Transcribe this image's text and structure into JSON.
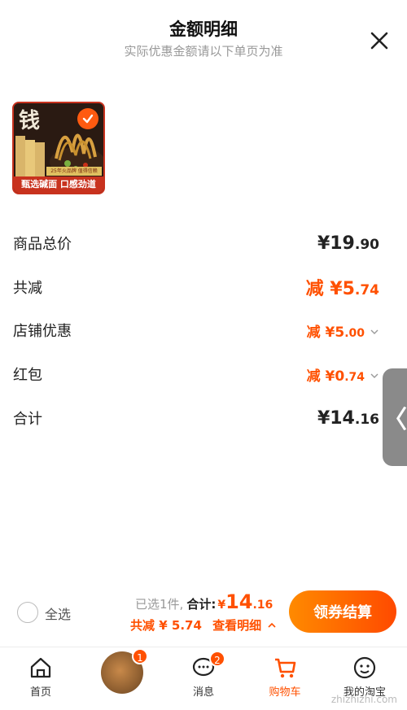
{
  "header": {
    "title": "金额明细",
    "subtitle": "实际优惠金额请以下单页为准"
  },
  "product": {
    "banner": "甄选碱面 口感劲道",
    "tag": "25年火品牌 值得信赖",
    "checked": true
  },
  "breakdown": [
    {
      "label": "商品总价",
      "prefix": "¥",
      "main": "19",
      "cents": ".90",
      "style": "normal"
    },
    {
      "label": "共减",
      "prefix": "减 ¥",
      "main": "5",
      "cents": ".74",
      "style": "orange"
    },
    {
      "label": "店铺优惠",
      "prefix": "减 ¥",
      "main": "5",
      "cents": ".00",
      "style": "orange-small"
    },
    {
      "label": "红包",
      "prefix": "减 ¥",
      "main": "0",
      "cents": ".74",
      "style": "orange-small"
    },
    {
      "label": "合计",
      "prefix": "¥",
      "main": "14",
      "cents": ".16",
      "style": "normal"
    }
  ],
  "side_tab": {
    "glyph": "〈"
  },
  "footer": {
    "select_all": "全选",
    "selected_count": "已选1件,",
    "total_label": "合计:",
    "total_currency": "¥",
    "total_main": "14",
    "total_cents": ".16",
    "discount_text": "共减 ¥ 5.74",
    "detail_link": "查看明细",
    "checkout_button": "领券结算"
  },
  "tabbar": {
    "tabs": [
      {
        "label": "首页",
        "icon": "home-icon"
      },
      {
        "label": "",
        "icon": "avatar",
        "badge": "1"
      },
      {
        "label": "消息",
        "icon": "message-icon",
        "badge": "2"
      },
      {
        "label": "购物车",
        "icon": "cart-icon",
        "active": true
      },
      {
        "label": "我的淘宝",
        "icon": "profile-icon"
      }
    ]
  },
  "watermark": "zhizhizhi.com",
  "colors": {
    "accent": "#ff5000",
    "button_gradient_start": "#ff8a00",
    "button_gradient_end": "#ff4a00"
  }
}
